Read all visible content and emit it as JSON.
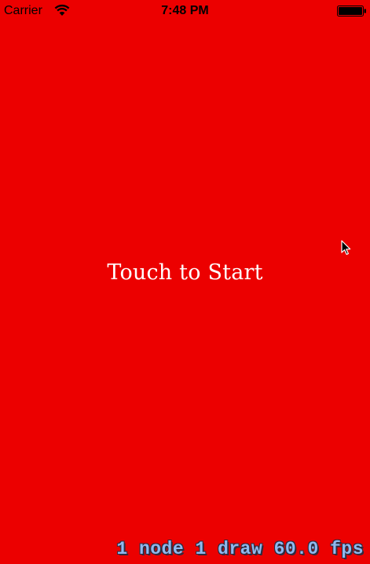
{
  "status_bar": {
    "carrier": "Carrier",
    "time": "7:48 PM",
    "icons": [
      "wifi-icon",
      "battery-icon"
    ]
  },
  "game": {
    "prompt": "Touch to Start",
    "background_color": "#ec0000"
  },
  "stats": {
    "text": "1 node 1 draw 60.0 fps"
  },
  "cursor": {
    "icon": "cursor-arrow-icon"
  }
}
